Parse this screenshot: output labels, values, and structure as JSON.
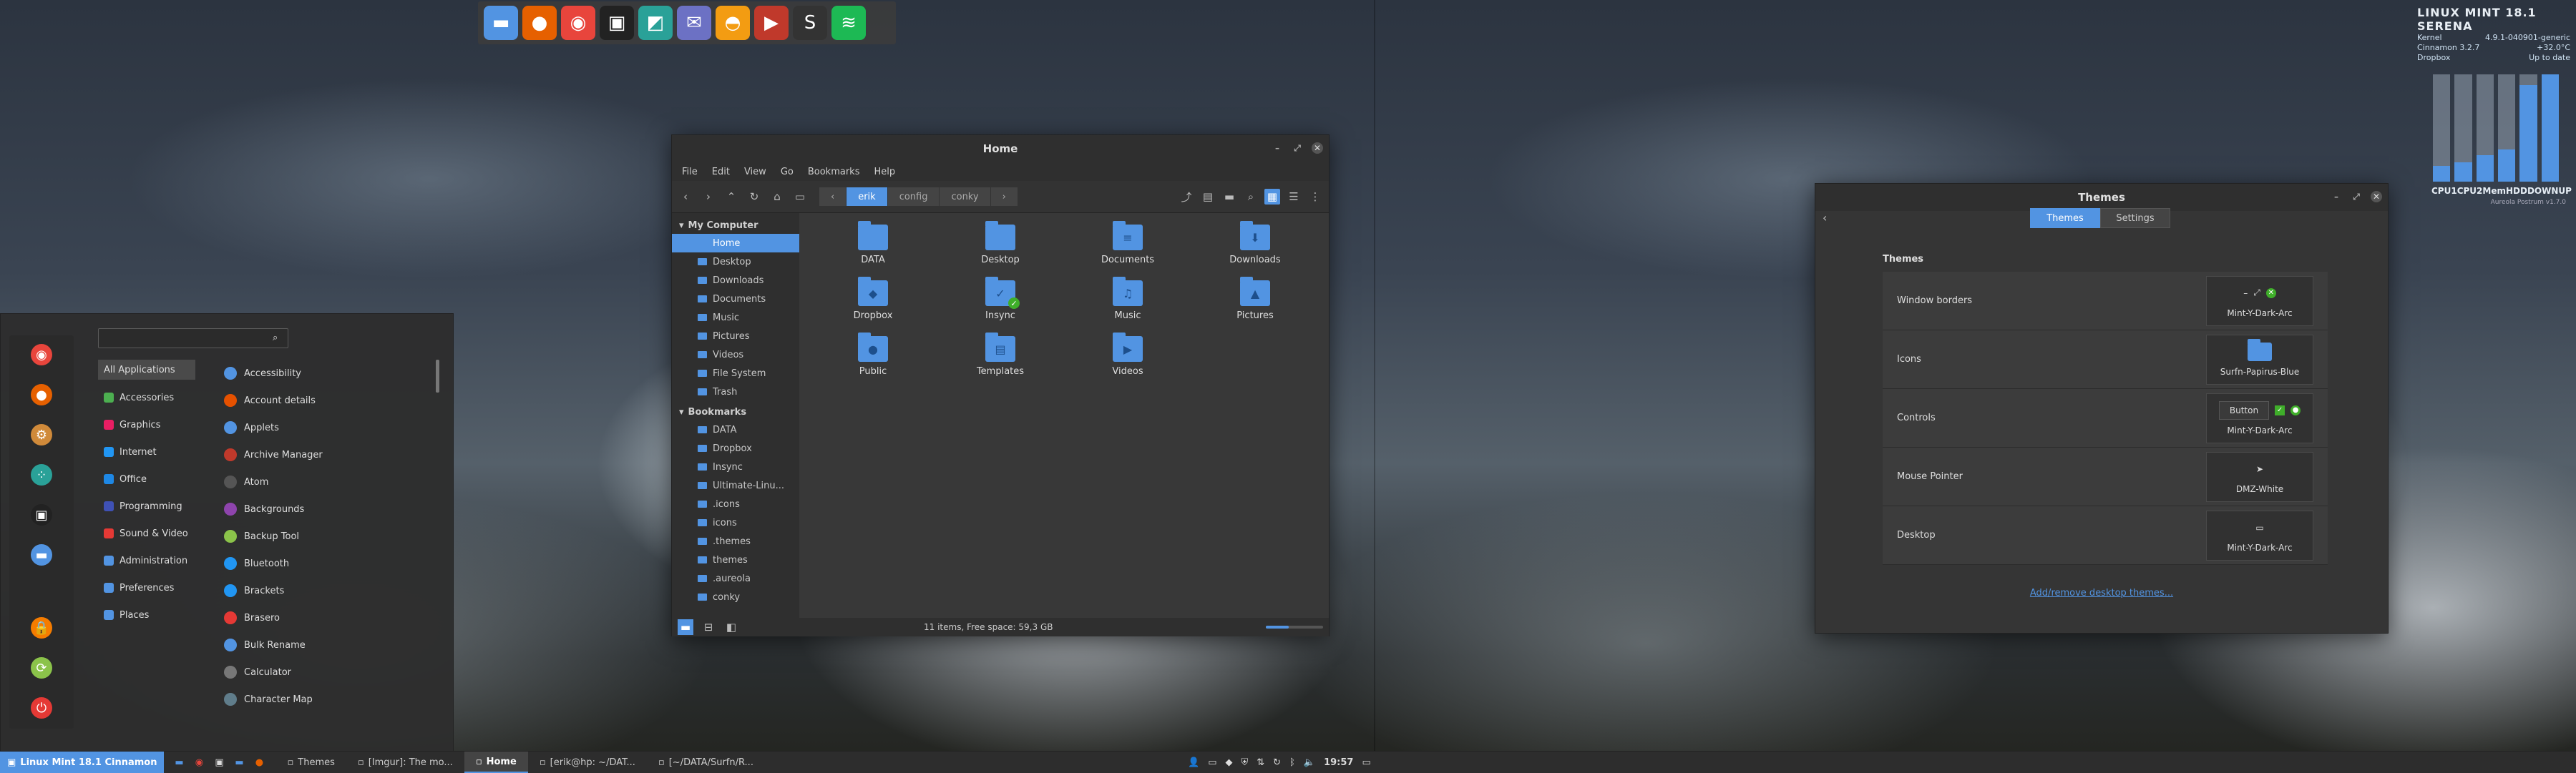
{
  "dock": {
    "icons": [
      {
        "name": "files-icon",
        "glyph": "▬",
        "color": "#5294e2"
      },
      {
        "name": "firefox-icon",
        "glyph": "●",
        "color": "#e66000"
      },
      {
        "name": "chromium-icon",
        "glyph": "◉",
        "color": "#e8453c"
      },
      {
        "name": "terminal-icon",
        "glyph": "▣",
        "color": "#222222"
      },
      {
        "name": "image-viewer-icon",
        "glyph": "◩",
        "color": "#2aa198"
      },
      {
        "name": "mail-icon",
        "glyph": "✉",
        "color": "#6c71c4"
      },
      {
        "name": "fish-icon",
        "glyph": "◓",
        "color": "#f39c12"
      },
      {
        "name": "video-icon",
        "glyph": "▶",
        "color": "#c0392b"
      },
      {
        "name": "steam-icon",
        "glyph": "S",
        "color": "#333333"
      },
      {
        "name": "spotify-icon",
        "glyph": "≋",
        "color": "#1db954"
      }
    ]
  },
  "file_manager": {
    "title": "Home",
    "menu": [
      "File",
      "Edit",
      "View",
      "Go",
      "Bookmarks",
      "Help"
    ],
    "path": [
      "erik",
      "config",
      "conky"
    ],
    "sidebar": {
      "computer_header": "My Computer",
      "computer_items": [
        "Home",
        "Desktop",
        "Downloads",
        "Documents",
        "Music",
        "Pictures",
        "Videos",
        "File System",
        "Trash"
      ],
      "bookmarks_header": "Bookmarks",
      "bookmark_items": [
        "DATA",
        "Dropbox",
        "Insync",
        "Ultimate-Linu...",
        ".icons",
        "icons",
        ".themes",
        "themes",
        ".aureola",
        "conky"
      ]
    },
    "files": [
      {
        "label": "DATA",
        "glyph": ""
      },
      {
        "label": "Desktop",
        "glyph": ""
      },
      {
        "label": "Documents",
        "glyph": "≡"
      },
      {
        "label": "Downloads",
        "glyph": "⬇"
      },
      {
        "label": "Dropbox",
        "glyph": "◆"
      },
      {
        "label": "Insync",
        "glyph": "✓"
      },
      {
        "label": "Music",
        "glyph": "♫"
      },
      {
        "label": "Pictures",
        "glyph": "▲"
      },
      {
        "label": "Public",
        "glyph": "●"
      },
      {
        "label": "Templates",
        "glyph": "▤"
      },
      {
        "label": "Videos",
        "glyph": "▶"
      }
    ],
    "status": "11 items, Free space: 59,3 GB",
    "zoom_level": 0.4
  },
  "start_menu": {
    "search_placeholder": "",
    "categories": [
      "All Applications",
      "Accessories",
      "Graphics",
      "Internet",
      "Office",
      "Programming",
      "Sound & Video",
      "Administration",
      "Preferences",
      "Places"
    ],
    "category_colors": [
      "#888888",
      "#4caf50",
      "#e91e63",
      "#2196f3",
      "#1e88e5",
      "#3f51b5",
      "#e53935",
      "#5294e2",
      "#5294e2",
      "#5294e2"
    ],
    "apps": [
      "Accessibility",
      "Account details",
      "Applets",
      "Archive Manager",
      "Atom",
      "Backgrounds",
      "Backup Tool",
      "Bluetooth",
      "Brackets",
      "Brasero",
      "Bulk Rename",
      "Calculator",
      "Character Map"
    ],
    "app_colors": [
      "#5294e2",
      "#e65100",
      "#5294e2",
      "#c0392b",
      "#555555",
      "#8e44ad",
      "#8bc34a",
      "#2196f3",
      "#2196f3",
      "#e53935",
      "#5294e2",
      "#777777",
      "#607d8b"
    ],
    "favorites": [
      {
        "name": "chromium-icon",
        "glyph": "◉",
        "color": "#e8453c"
      },
      {
        "name": "firefox-icon",
        "glyph": "●",
        "color": "#e66000"
      },
      {
        "name": "settings-icon",
        "glyph": "⚙",
        "color": "#d08a3a"
      },
      {
        "name": "network-icon",
        "glyph": "⁘",
        "color": "#2aa198"
      },
      {
        "name": "terminal-icon",
        "glyph": "▣",
        "color": "#222222"
      },
      {
        "name": "files-icon",
        "glyph": "▬",
        "color": "#5294e2"
      },
      {
        "name": "lock-icon",
        "glyph": "🔒",
        "color": "#f57c00"
      },
      {
        "name": "logout-icon",
        "glyph": "⟳",
        "color": "#8bc34a"
      },
      {
        "name": "power-icon",
        "glyph": "⏻",
        "color": "#e53935"
      }
    ]
  },
  "themes": {
    "title": "Themes",
    "tabs": [
      "Themes",
      "Settings"
    ],
    "section": "Themes",
    "rows": [
      {
        "label": "Window borders",
        "value": "Mint-Y-Dark-Arc"
      },
      {
        "label": "Icons",
        "value": "Surfn-Papirus-Blue"
      },
      {
        "label": "Controls",
        "value": "Mint-Y-Dark-Arc",
        "button": "Button"
      },
      {
        "label": "Mouse Pointer",
        "value": "DMZ-White"
      },
      {
        "label": "Desktop",
        "value": "Mint-Y-Dark-Arc"
      }
    ],
    "link": "Add/remove desktop themes..."
  },
  "conky": {
    "title": "LINUX MINT 18.1 SERENA",
    "kernel_label": "Kernel",
    "kernel_value": "4.9.1-040901-generic",
    "cinnamon_label": "Cinnamon 3.2.7",
    "temp_value": "+32.0°C",
    "dropbox_label": "Dropbox",
    "dropbox_value": "Up to date",
    "bars": [
      0.15,
      0.18,
      0.25,
      0.3,
      0.9,
      1.0
    ],
    "bar_labels": [
      "CPU1",
      "CPU2",
      "Mem",
      "HDD",
      "DOWN",
      "UP"
    ],
    "footer": "Aureola Postrum v1.7.0"
  },
  "taskbar": {
    "menu_label": "Linux Mint 18.1 Cinnamon",
    "tasks": [
      {
        "label": "Themes",
        "active": false
      },
      {
        "label": "[Imgur]: The mo...",
        "active": false
      },
      {
        "label": "Home",
        "active": true
      },
      {
        "label": "[erik@hp: ~/DAT...",
        "active": false
      },
      {
        "label": "[~/DATA/Surfn/R...",
        "active": false
      }
    ],
    "clock": "19:57"
  }
}
